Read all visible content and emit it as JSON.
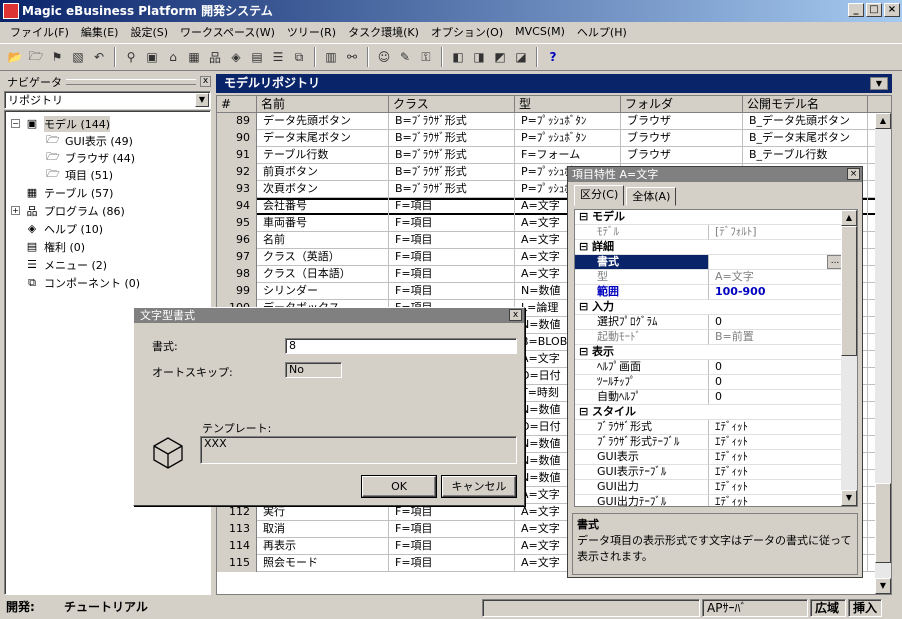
{
  "window": {
    "title": "Magic eBusiness Platform 開発システム",
    "min": "_",
    "max": "□",
    "close": "×"
  },
  "menu": [
    "ファイル(F)",
    "編集(E)",
    "設定(S)",
    "ワークスペース(W)",
    "ツリー(R)",
    "タスク環境(K)",
    "オプション(O)",
    "MVCS(M)",
    "ヘルプ(H)"
  ],
  "nav": {
    "title": "ナビゲータ",
    "close": "x",
    "select_value": "リポジトリ",
    "tree": [
      {
        "label": "モデル (144)",
        "expander": "−",
        "icon": "▣"
      },
      {
        "label": "GUI表示 (49)",
        "icon": "🗁"
      },
      {
        "label": "ブラウザ (44)",
        "icon": "🗁"
      },
      {
        "label": "項目 (51)",
        "icon": "🗁"
      },
      {
        "label": "テーブル (57)",
        "icon": "▦"
      },
      {
        "label": "プログラム (86)",
        "expander": "+",
        "icon": "品"
      },
      {
        "label": "ヘルプ (10)",
        "icon": "◈"
      },
      {
        "label": "権利 (0)",
        "icon": "▤"
      },
      {
        "label": "メニュー (2)",
        "icon": "☰"
      },
      {
        "label": "コンポーネント (0)",
        "icon": "⧉"
      }
    ]
  },
  "repo": {
    "title": "モデルリポジトリ",
    "columns": [
      "#",
      "名前",
      "クラス",
      "型",
      "フォルダ",
      "公開モデル名"
    ],
    "rows": [
      [
        "89",
        "データ先頭ボタン",
        "B=ﾌﾞﾗｳｻﾞ形式",
        "P=ﾌﾟｯｼｭﾎﾞﾀﾝ",
        "ブラウザ",
        "B_データ先頭ボタン"
      ],
      [
        "90",
        "データ末尾ボタン",
        "B=ﾌﾞﾗｳｻﾞ形式",
        "P=ﾌﾟｯｼｭﾎﾞﾀﾝ",
        "ブラウザ",
        "B_データ末尾ボタン"
      ],
      [
        "91",
        "テーブル行数",
        "B=ﾌﾞﾗｳｻﾞ形式",
        "F=フォーム",
        "ブラウザ",
        "B_テーブル行数"
      ],
      [
        "92",
        "前頁ボタン",
        "B=ﾌﾞﾗｳｻﾞ形式",
        "P=ﾌﾟｯｼｭﾎﾞﾀﾝ",
        "",
        ""
      ],
      [
        "93",
        "次頁ボタン",
        "B=ﾌﾞﾗｳｻﾞ形式",
        "P=ﾌﾟｯｼｭﾎﾞﾀﾝ",
        "",
        ""
      ],
      [
        "94",
        "会社番号",
        "F=項目",
        "A=文字",
        "",
        ""
      ],
      [
        "95",
        "車両番号",
        "F=項目",
        "A=文字",
        "",
        ""
      ],
      [
        "96",
        "名前",
        "F=項目",
        "A=文字",
        "",
        ""
      ],
      [
        "97",
        "クラス（英語）",
        "F=項目",
        "A=文字",
        "",
        ""
      ],
      [
        "98",
        "クラス（日本語）",
        "F=項目",
        "A=文字",
        "",
        ""
      ],
      [
        "99",
        "シリンダー",
        "F=項目",
        "N=数値",
        "",
        ""
      ],
      [
        "100",
        "データボックス",
        "F=項目",
        "L=論理",
        "",
        ""
      ],
      [
        "101",
        "",
        "F=項目",
        "N=数値",
        "",
        ""
      ],
      [
        "102",
        "",
        "F=項目",
        "B=BLOB",
        "",
        ""
      ],
      [
        "103",
        "",
        "F=項目",
        "A=文字",
        "",
        ""
      ],
      [
        "104",
        "",
        "F=項目",
        "D=日付",
        "",
        ""
      ],
      [
        "105",
        "",
        "F=項目",
        "T=時刻",
        "",
        ""
      ],
      [
        "106",
        "",
        "F=項目",
        "N=数値",
        "",
        ""
      ],
      [
        "107",
        "",
        "F=項目",
        "D=日付",
        "",
        ""
      ],
      [
        "108",
        "",
        "F=項目",
        "N=数値",
        "",
        ""
      ],
      [
        "109",
        "",
        "F=項目",
        "N=数値",
        "",
        ""
      ],
      [
        "110",
        "",
        "F=項目",
        "N=数値",
        "",
        ""
      ],
      [
        "111",
        "",
        "F=項目",
        "A=文字",
        "",
        ""
      ],
      [
        "112",
        "実行",
        "F=項目",
        "A=文字",
        "",
        ""
      ],
      [
        "113",
        "取消",
        "F=項目",
        "A=文字",
        "",
        ""
      ],
      [
        "114",
        "再表示",
        "F=項目",
        "A=文字",
        "",
        ""
      ],
      [
        "115",
        "照会モード",
        "F=項目",
        "A=文字",
        "",
        ""
      ]
    ]
  },
  "props": {
    "title": "項目特性 A=文字",
    "tabs": [
      "区分(C)",
      "全体(A)"
    ],
    "rows": [
      {
        "t": "sec",
        "k": "⊟ モデル"
      },
      {
        "t": "dim",
        "k": "ﾓﾃﾞﾙ",
        "v": "[ﾃﾞﾌｫﾙﾄ]"
      },
      {
        "t": "sec",
        "k": "⊟ 詳細"
      },
      {
        "t": "hl",
        "k": "書式",
        "v": "",
        "btn": "..."
      },
      {
        "t": "dim",
        "k": "型",
        "v": "A=文字"
      },
      {
        "t": "blue",
        "k": "範囲",
        "v": "100-900"
      },
      {
        "t": "sec",
        "k": "⊟ 入力"
      },
      {
        "t": "",
        "k": "選択ﾌﾟﾛｸﾞﾗﾑ",
        "v": "0"
      },
      {
        "t": "dim",
        "k": "起動ﾓｰﾄﾞ",
        "v": "B=前置"
      },
      {
        "t": "sec",
        "k": "⊟ 表示"
      },
      {
        "t": "",
        "k": "ﾍﾙﾌﾟ画面",
        "v": "0"
      },
      {
        "t": "",
        "k": "ﾂｰﾙﾁｯﾌﾟ",
        "v": "0"
      },
      {
        "t": "",
        "k": "自動ﾍﾙﾌﾟ",
        "v": "0"
      },
      {
        "t": "sec",
        "k": "⊟ スタイル"
      },
      {
        "t": "",
        "k": "ﾌﾞﾗｳｻﾞ形式",
        "v": "ｴﾃﾞｨｯﾄ"
      },
      {
        "t": "",
        "k": "ﾌﾞﾗｳｻﾞ形式ﾃｰﾌﾞﾙ",
        "v": "ｴﾃﾞｨｯﾄ"
      },
      {
        "t": "",
        "k": "GUI表示",
        "v": "ｴﾃﾞｨｯﾄ"
      },
      {
        "t": "",
        "k": "GUI表示ﾃｰﾌﾞﾙ",
        "v": "ｴﾃﾞｨｯﾄ"
      },
      {
        "t": "",
        "k": "GUI出力",
        "v": "ｴﾃﾞｨｯﾄ"
      },
      {
        "t": "",
        "k": "GUI出力ﾃｰﾌﾞﾙ",
        "v": "ｴﾃﾞｨｯﾄ"
      }
    ],
    "desc_title": "書式",
    "desc_text": "データ項目の表示形式です文字はデータの書式に従って表示されます。"
  },
  "fmt": {
    "title": "文字型書式",
    "close": "x",
    "format_label": "書式:",
    "format_value": "8",
    "autoskip_label": "オートスキップ:",
    "autoskip_value": "No",
    "template_label": "テンプレート:",
    "template_value": "XXX",
    "ok": "OK",
    "cancel": "キャンセル"
  },
  "status": {
    "mode": "開発:",
    "project": "チュートリアル",
    "server": "APｻｰﾊﾞ",
    "scope": "広域",
    "insert": "挿入"
  }
}
